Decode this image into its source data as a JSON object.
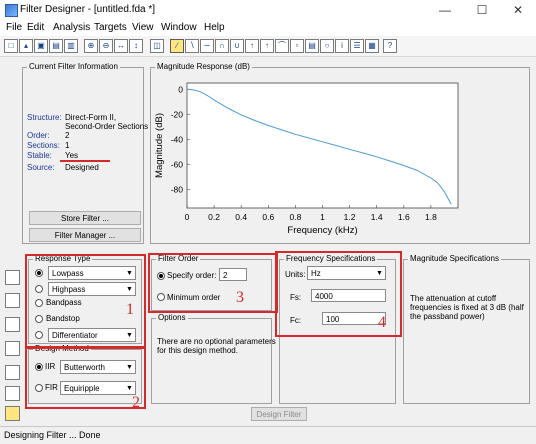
{
  "window": {
    "title": "Filter Designer - [untitled.fda *]",
    "min_icon": "minimize-icon",
    "max_icon": "maximize-icon",
    "close_icon": "close-icon"
  },
  "menu": [
    "File",
    "Edit",
    "Analysis",
    "Targets",
    "View",
    "Window",
    "Help"
  ],
  "current_filter": {
    "title": "Current Filter Information",
    "rows": [
      {
        "label": "Structure:",
        "value": "Direct-Form II,"
      },
      {
        "label": "",
        "value": "Second-Order Sections"
      },
      {
        "label": "Order:",
        "value": "2"
      },
      {
        "label": "Sections:",
        "value": "1"
      },
      {
        "label": "Stable:",
        "value": "Yes"
      },
      {
        "label": "Source:",
        "value": "Designed"
      }
    ],
    "store_button": "Store Filter ...",
    "manager_button": "Filter Manager ..."
  },
  "magnitude": {
    "title": "Magnitude Response (dB)",
    "chart_data": {
      "type": "line",
      "xlabel": "Frequency (kHz)",
      "ylabel": "Magnitude (dB)",
      "xlim": [
        0,
        2
      ],
      "ylim": [
        -95,
        5
      ],
      "xticks": [
        "0",
        "0.2",
        "0.4",
        "0.6",
        "0.8",
        "1",
        "1.2",
        "1.4",
        "1.6",
        "1.8"
      ],
      "yticks": [
        "0",
        "-20",
        "-40",
        "-60",
        "-80"
      ],
      "x": [
        0,
        0.05,
        0.1,
        0.15,
        0.2,
        0.3,
        0.4,
        0.5,
        0.6,
        0.7,
        0.8,
        0.9,
        1.0,
        1.1,
        1.2,
        1.3,
        1.4,
        1.5,
        1.6,
        1.7,
        1.8,
        1.85,
        1.9,
        1.95
      ],
      "y": [
        0,
        -0.5,
        -2,
        -5,
        -8.5,
        -15,
        -20.5,
        -25,
        -29,
        -32.5,
        -36,
        -39,
        -42,
        -45,
        -48,
        -51,
        -54,
        -57.5,
        -61,
        -65,
        -71,
        -75,
        -82,
        -92
      ],
      "grid": false,
      "color": "#4f9bd4"
    }
  },
  "response_type": {
    "title": "Response Type",
    "options": [
      "Lowpass",
      "Highpass",
      "Bandpass",
      "Bandstop",
      "Differentiator"
    ],
    "lowpass_dd": "Lowpass",
    "highpass_dd": "Highpass",
    "diff_dd": "Differentiator"
  },
  "design_method": {
    "title": "Design Method",
    "iir_label": "IIR",
    "iir_value": "Butterworth",
    "fir_label": "FIR",
    "fir_value": "Equiripple"
  },
  "filter_order": {
    "title": "Filter Order",
    "specify_label": "Specify order:",
    "specify_value": "2",
    "minimum_label": "Minimum order"
  },
  "options": {
    "title": "Options",
    "text1": "There are no optional parameters",
    "text2": "for this design method."
  },
  "freq_spec": {
    "title": "Frequency Specifications",
    "units_label": "Units:",
    "units_value": "Hz",
    "fs_label": "Fs:",
    "fs_value": "4000",
    "fc_label": "Fc:",
    "fc_value": "100"
  },
  "mag_spec": {
    "title": "Magnitude Specifications",
    "text1": "The attenuation at cutoff",
    "text2": "frequencies is fixed at 3 dB (half",
    "text3": "the passband power)"
  },
  "annotations": {
    "n1": "1",
    "n2": "2",
    "n3": "3",
    "n4": "4"
  },
  "design_button": "Design Filter",
  "status": "Designing Filter ... Done"
}
